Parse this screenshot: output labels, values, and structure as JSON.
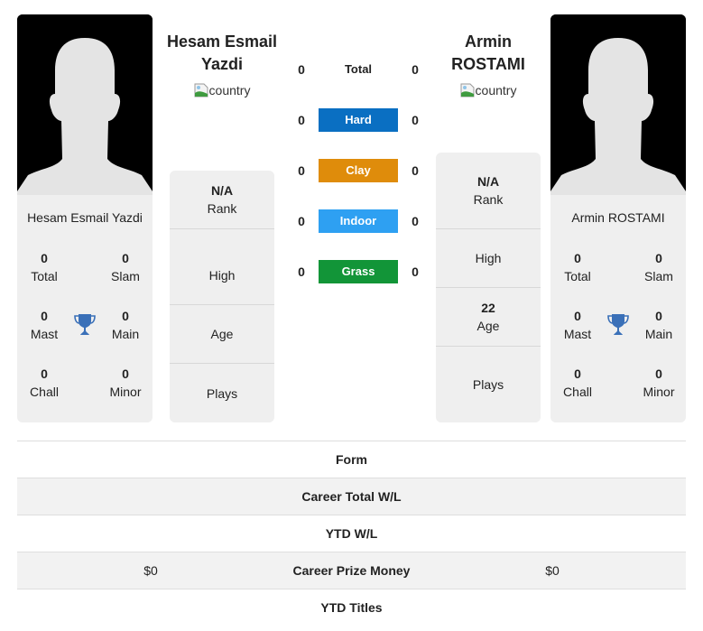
{
  "player_left": {
    "name": "Hesam Esmail Yazdi",
    "heading_line1": "Hesam Esmail",
    "heading_line2": "Yazdi",
    "country_alt": "country",
    "titles": {
      "total": {
        "value": "0",
        "label": "Total"
      },
      "slam": {
        "value": "0",
        "label": "Slam"
      },
      "mast": {
        "value": "0",
        "label": "Mast"
      },
      "main": {
        "value": "0",
        "label": "Main"
      },
      "chall": {
        "value": "0",
        "label": "Chall"
      },
      "minor": {
        "value": "0",
        "label": "Minor"
      }
    },
    "info": {
      "rank": {
        "value": "N/A",
        "label": "Rank"
      },
      "high": {
        "value": "",
        "label": "High"
      },
      "age": {
        "value": "",
        "label": "Age"
      },
      "plays": {
        "value": "",
        "label": "Plays"
      }
    }
  },
  "player_right": {
    "name": "Armin ROSTAMI",
    "heading_line1": "Armin",
    "heading_line2": "ROSTAMI",
    "country_alt": "country",
    "titles": {
      "total": {
        "value": "0",
        "label": "Total"
      },
      "slam": {
        "value": "0",
        "label": "Slam"
      },
      "mast": {
        "value": "0",
        "label": "Mast"
      },
      "main": {
        "value": "0",
        "label": "Main"
      },
      "chall": {
        "value": "0",
        "label": "Chall"
      },
      "minor": {
        "value": "0",
        "label": "Minor"
      }
    },
    "info": {
      "rank": {
        "value": "N/A",
        "label": "Rank"
      },
      "high": {
        "value": "",
        "label": "High"
      },
      "age": {
        "value": "22",
        "label": "Age"
      },
      "plays": {
        "value": "",
        "label": "Plays"
      }
    }
  },
  "h2h": [
    {
      "surface": "Total",
      "left": "0",
      "right": "0",
      "color": ""
    },
    {
      "surface": "Hard",
      "left": "0",
      "right": "0",
      "color": "#0a6fc2"
    },
    {
      "surface": "Clay",
      "left": "0",
      "right": "0",
      "color": "#df8c0b"
    },
    {
      "surface": "Indoor",
      "left": "0",
      "right": "0",
      "color": "#2ea0f2"
    },
    {
      "surface": "Grass",
      "left": "0",
      "right": "0",
      "color": "#129538"
    }
  ],
  "comparison": [
    {
      "label": "Form",
      "left": "",
      "right": ""
    },
    {
      "label": "Career Total W/L",
      "left": "",
      "right": ""
    },
    {
      "label": "YTD W/L",
      "left": "",
      "right": ""
    },
    {
      "label": "Career Prize Money",
      "left": "$0",
      "right": "$0"
    },
    {
      "label": "YTD Titles",
      "left": "",
      "right": ""
    }
  ],
  "colors": {
    "trophy": "#3a70b8",
    "card_bg": "#efefef"
  }
}
